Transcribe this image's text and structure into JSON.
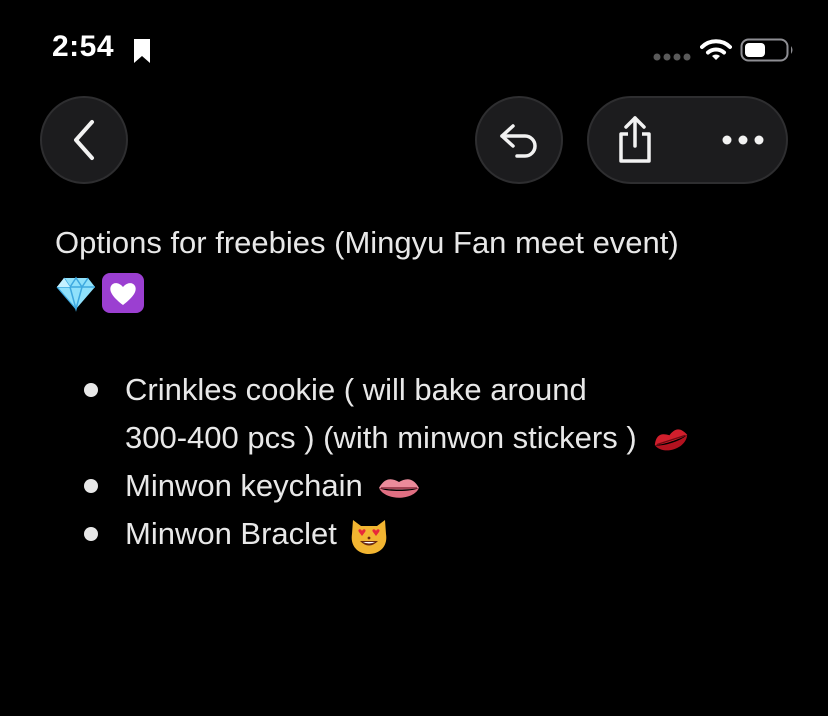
{
  "status_bar": {
    "time": "2:54",
    "icons": [
      "bookmark-icon",
      "signal-icon",
      "wifi-icon",
      "battery-icon"
    ]
  },
  "toolbar": {
    "back": "chevron-left-icon",
    "reply": "reply-icon",
    "share": "share-icon",
    "more": "ellipsis-icon"
  },
  "note": {
    "title": "Options for freebies (Mingyu Fan meet event)",
    "title_emojis": [
      "gem-emoji",
      "purple-heart-emoji"
    ],
    "items": [
      {
        "line1": "Crinkles cookie ( will bake around",
        "line2": "300-400 pcs ) (with minwon stickers )",
        "emoji": "kiss-mark-emoji"
      },
      {
        "text": "Minwon keychain",
        "emoji": "lips-emoji"
      },
      {
        "text": "Minwon Braclet",
        "emoji": "heart-eyes-cat-emoji"
      }
    ]
  },
  "colors": {
    "background": "#000000",
    "button_fill": "#1c1c1e",
    "text": "#e8e8e8",
    "heart_purple": "#9b3fd1",
    "gem_blue": "#6fd0f5",
    "kiss_red": "#d11f2c",
    "lips_pink": "#e8778a",
    "cat_yellow": "#f2b531"
  }
}
